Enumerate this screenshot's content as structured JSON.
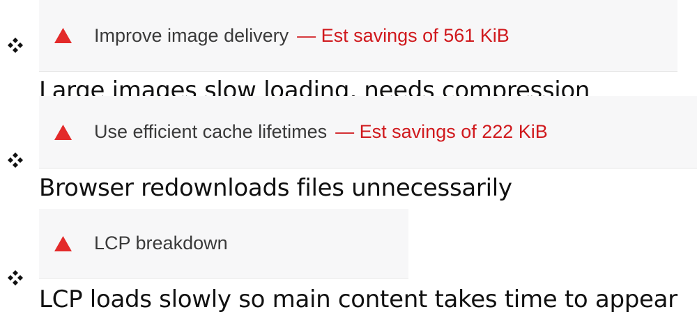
{
  "items": [
    {
      "title": "Improve image delivery",
      "savings": "— Est savings of 561 KiB",
      "description": "Large images slow loading, needs compression"
    },
    {
      "title": "Use efficient cache lifetimes",
      "savings": "— Est savings of 222 KiB",
      "description": "Browser redownloads files unnecessarily"
    },
    {
      "title": "LCP breakdown",
      "savings": "",
      "description": "LCP loads slowly so main content takes time to appear"
    }
  ],
  "icons": {
    "bullet": "four-diamond-bullet-icon",
    "warning": "warning-triangle-icon"
  },
  "colors": {
    "warning": "#e32a2a",
    "savings": "#d0191d",
    "chip_background": "#f7f7f8",
    "title_text": "#3a3a3a",
    "description_text": "#111111"
  }
}
